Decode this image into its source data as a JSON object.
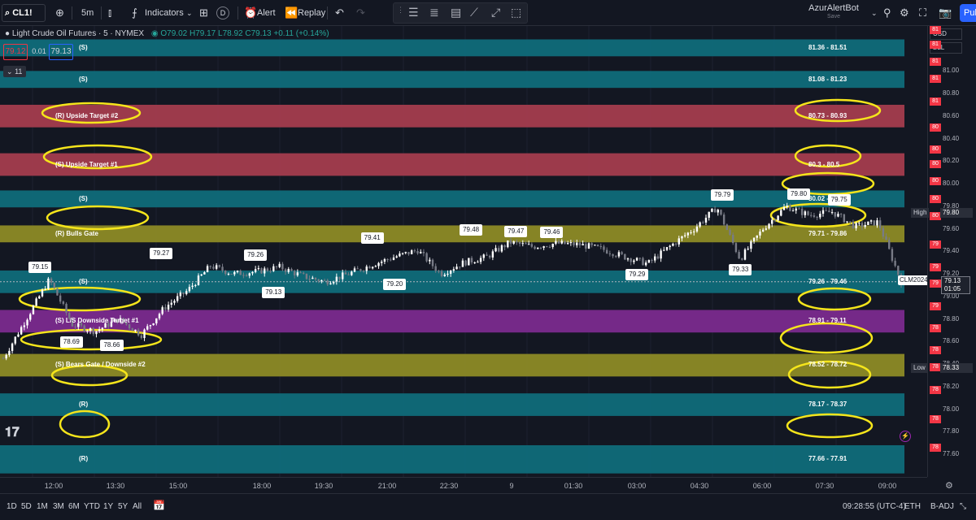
{
  "topbar": {
    "symbol": "CL1!",
    "interval": "5m",
    "indicators_label": "Indicators",
    "alert_label": "Alert",
    "replay_label": "Replay",
    "user_name": "AzurAlertBot",
    "save_label": "Save",
    "publish_label": "Pub"
  },
  "legend": {
    "title": "Light Crude Oil Futures · 5 · NYMEX",
    "ohlc": "O79.02 H79.17 L78.92 C79.13 +0.11 (+0.14%)",
    "bid": "79.12",
    "spread": "0.01",
    "ask": "79.13",
    "indicator_count": "11"
  },
  "zones": [
    {
      "label": "(S)",
      "range": "81.36 - 81.51",
      "color": "#0f6b7a",
      "lo": 81.36,
      "hi": 81.51
    },
    {
      "label": "(S)",
      "range": "81.08 - 81.23",
      "color": "#0f6b7a",
      "lo": 81.08,
      "hi": 81.23
    },
    {
      "label": "(R) Upside Target #2",
      "range": "80.73 - 80.93",
      "color": "#a33c4e",
      "lo": 80.73,
      "hi": 80.93
    },
    {
      "label": "(S) Upside Target #1",
      "range": "80.3 - 80.5",
      "color": "#a33c4e",
      "lo": 80.3,
      "hi": 80.5
    },
    {
      "label": "(S)",
      "range": "80.02 - 80.17",
      "color": "#0f6b7a",
      "lo": 80.02,
      "hi": 80.17
    },
    {
      "label": "(R) Bulls Gate",
      "range": "79.71 - 79.86",
      "color": "#8c8a26",
      "lo": 79.71,
      "hi": 79.86
    },
    {
      "label": "(S)",
      "range": "79.26 - 79.46",
      "color": "#0f6b7a",
      "lo": 79.26,
      "hi": 79.46
    },
    {
      "label": "(S) L/S Downside Target #1",
      "range": "78.91 - 79.11",
      "color": "#7a2a8e",
      "lo": 78.91,
      "hi": 79.11
    },
    {
      "label": "(S) Bears Gate / Downside #2",
      "range": "78.52 - 78.72",
      "color": "#8c8a26",
      "lo": 78.52,
      "hi": 78.72
    },
    {
      "label": "(R)",
      "range": "78.17 - 78.37",
      "color": "#0f6b7a",
      "lo": 78.17,
      "hi": 78.37
    },
    {
      "label": "(R)",
      "range": "77.66 - 77.91",
      "color": "#0f6b7a",
      "lo": 77.66,
      "hi": 77.91
    }
  ],
  "chart_data": {
    "type": "candlestick",
    "title": "Light Crude Oil Futures · 5 · NYMEX",
    "ylim": [
      77.6,
      81.6
    ],
    "x": [
      "12:00",
      "13:30",
      "15:00",
      "18:00",
      "19:30",
      "21:00",
      "22:30",
      "9",
      "01:30",
      "03:00",
      "04:30",
      "06:00",
      "07:30",
      "09:00"
    ],
    "close_path": [
      78.45,
      78.8,
      79.15,
      78.75,
      78.69,
      78.8,
      78.66,
      78.9,
      79.05,
      79.27,
      79.2,
      79.22,
      79.26,
      79.18,
      79.13,
      79.2,
      79.28,
      79.35,
      79.41,
      79.2,
      79.3,
      79.35,
      79.48,
      79.44,
      79.47,
      79.46,
      79.42,
      79.35,
      79.29,
      79.45,
      79.6,
      79.79,
      79.33,
      79.6,
      79.8,
      79.72,
      79.75,
      79.62,
      79.66,
      79.13
    ],
    "callouts": [
      {
        "value": "79.15",
        "t": 0.04,
        "above": true
      },
      {
        "value": "78.69",
        "t": 0.075,
        "above": false
      },
      {
        "value": "78.66",
        "t": 0.12,
        "above": false
      },
      {
        "value": "79.27",
        "t": 0.175,
        "above": true
      },
      {
        "value": "79.26",
        "t": 0.28,
        "above": true
      },
      {
        "value": "79.13",
        "t": 0.3,
        "above": false
      },
      {
        "value": "79.41",
        "t": 0.41,
        "above": true
      },
      {
        "value": "79.20",
        "t": 0.435,
        "above": false
      },
      {
        "value": "79.48",
        "t": 0.52,
        "above": true
      },
      {
        "value": "79.47",
        "t": 0.57,
        "above": true
      },
      {
        "value": "79.46",
        "t": 0.61,
        "above": true
      },
      {
        "value": "79.29",
        "t": 0.705,
        "above": false
      },
      {
        "value": "79.79",
        "t": 0.8,
        "above": true
      },
      {
        "value": "79.33",
        "t": 0.82,
        "above": false
      },
      {
        "value": "79.80",
        "t": 0.885,
        "above": true
      },
      {
        "value": "79.75",
        "t": 0.93,
        "above": true
      }
    ],
    "current_price": "79.13",
    "current_countdown": "01:05",
    "contract_tag": "CLM2024",
    "high_label": "High",
    "high_value": "79.80",
    "low_label": "Low",
    "low_value": "78.33"
  },
  "price_axis": {
    "currency": "USD",
    "unit": "BLL",
    "ticks": [
      "81.20",
      "81.00",
      "80.80",
      "80.60",
      "80.40",
      "80.20",
      "80.00",
      "79.80",
      "79.60",
      "79.40",
      "79.20",
      "79.00",
      "78.80",
      "78.60",
      "78.40",
      "78.20",
      "78.00",
      "77.80",
      "77.60"
    ],
    "zone_tags": [
      "81",
      "81",
      "81",
      "81",
      "81",
      "81",
      "80",
      "80",
      "80",
      "80",
      "80",
      "80",
      "79",
      "79",
      "79",
      "79",
      "78",
      "78",
      "78",
      "78",
      "78",
      "78"
    ]
  },
  "bottombar": {
    "ranges": [
      "1D",
      "5D",
      "1M",
      "3M",
      "6M",
      "YTD",
      "1Y",
      "5Y",
      "All"
    ],
    "clock": "09:28:55 (UTC-4)",
    "session": "ETH",
    "adjust": "B-ADJ"
  }
}
